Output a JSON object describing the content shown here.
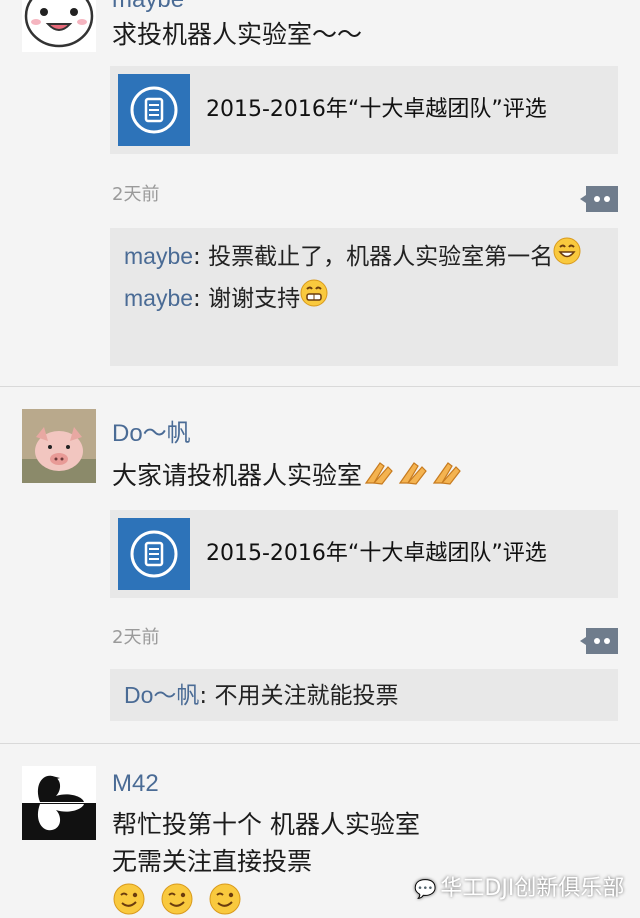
{
  "posts": [
    {
      "username": "maybe",
      "message": "求投机器人实验室～～",
      "link_title": "2015-2016年“十大卓越团队”评选",
      "timestamp": "2天前",
      "comments": [
        {
          "author": "maybe",
          "sep": ": ",
          "text": "投票截止了，机器人实验室第一名"
        },
        {
          "author": "maybe",
          "sep": ": ",
          "text": "谢谢支持"
        }
      ]
    },
    {
      "username": "Do～帆",
      "message": "大家请投机器人实验室",
      "link_title": "2015-2016年“十大卓越团队”评选",
      "timestamp": "2天前",
      "comments": [
        {
          "author": "Do～帆",
          "sep": ": ",
          "text": "不用关注就能投票"
        }
      ]
    },
    {
      "username": "M42",
      "message_line1": "帮忙投第十个 机器人实验室",
      "message_line2": "无需关注直接投票"
    }
  ],
  "icons": {
    "link_icon": "document-icon",
    "comment_icon": "comment-bubble-icon",
    "emoji_grin": "grin-emoji",
    "emoji_prayer": "clap-hands-emoji",
    "emoji_wink": "wink-emoji"
  },
  "colors": {
    "username": "#4a6b95",
    "link_icon_bg": "#2d73b9",
    "card_bg": "#e8e8e8"
  },
  "watermark": "华工DJI创新俱乐部"
}
